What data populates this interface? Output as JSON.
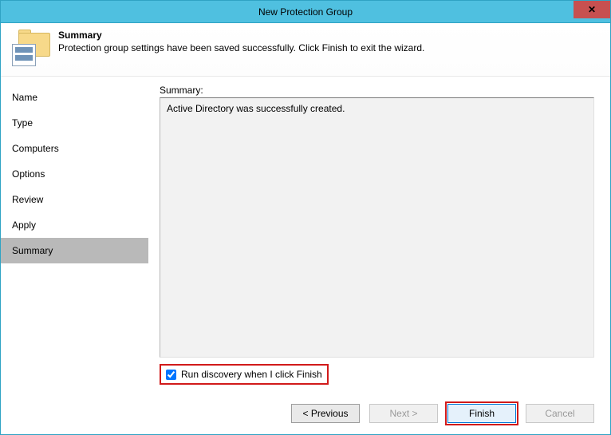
{
  "window": {
    "title": "New Protection Group",
    "close_glyph": "✕"
  },
  "header": {
    "title": "Summary",
    "subtitle": "Protection group settings have been saved successfully. Click Finish to exit the wizard."
  },
  "nav": {
    "items": [
      {
        "label": "Name"
      },
      {
        "label": "Type"
      },
      {
        "label": "Computers"
      },
      {
        "label": "Options"
      },
      {
        "label": "Review"
      },
      {
        "label": "Apply"
      },
      {
        "label": "Summary"
      }
    ],
    "active_index": 6
  },
  "content": {
    "summary_label": "Summary:",
    "summary_text": "Active Directory was successfully created.",
    "discovery_checkbox_label": "Run discovery when I click Finish",
    "discovery_checked": true
  },
  "buttons": {
    "previous": "< Previous",
    "next": "Next >",
    "finish": "Finish",
    "cancel": "Cancel"
  },
  "highlight": {
    "color": "#d11a1a"
  }
}
